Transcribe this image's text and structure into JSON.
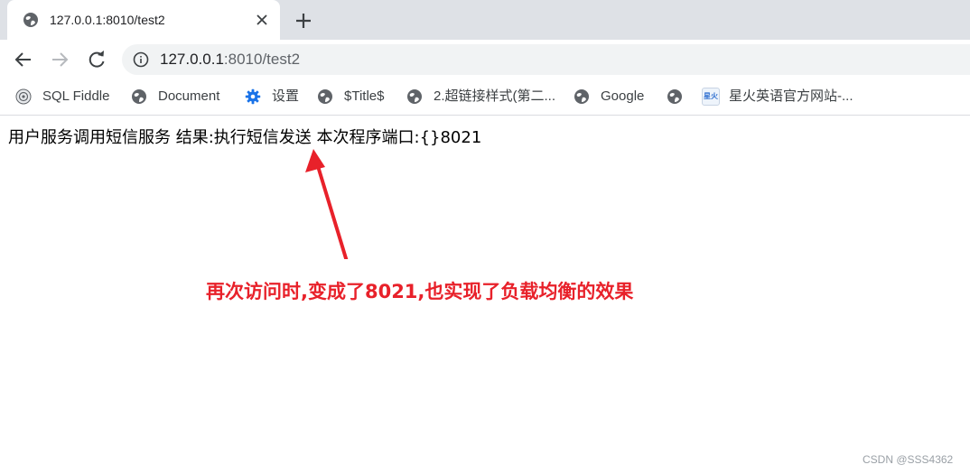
{
  "tab": {
    "title": "127.0.0.1:8010/test2"
  },
  "address_bar": {
    "host": "127.0.0.1",
    "path": ":8010/test2"
  },
  "bookmarks": [
    {
      "label": "SQL Fiddle",
      "icon": "sql-fiddle-icon"
    },
    {
      "label": "Document",
      "icon": "globe-icon"
    },
    {
      "label": "设置",
      "icon": "gear-icon"
    },
    {
      "label": "$Title$",
      "icon": "globe-icon"
    },
    {
      "label": "2.超链接样式(第二...",
      "icon": "globe-icon"
    },
    {
      "label": "Google",
      "icon": "globe-icon"
    },
    {
      "label": "",
      "icon": "globe-icon"
    },
    {
      "label": "星火英语官方网站-...",
      "icon": "xinghuo-icon",
      "icon_text": "星火"
    }
  ],
  "page": {
    "response_text": "用户服务调用短信服务 结果:执行短信发送 本次程序端口:{}8021",
    "annotation": "再次访问时,变成了8021,也实现了负载均衡的效果",
    "watermark": "CSDN @SSS4362"
  },
  "colors": {
    "tabstrip": "#dee1e6",
    "annotation": "#e8212a",
    "omnibox": "#f1f3f4"
  }
}
